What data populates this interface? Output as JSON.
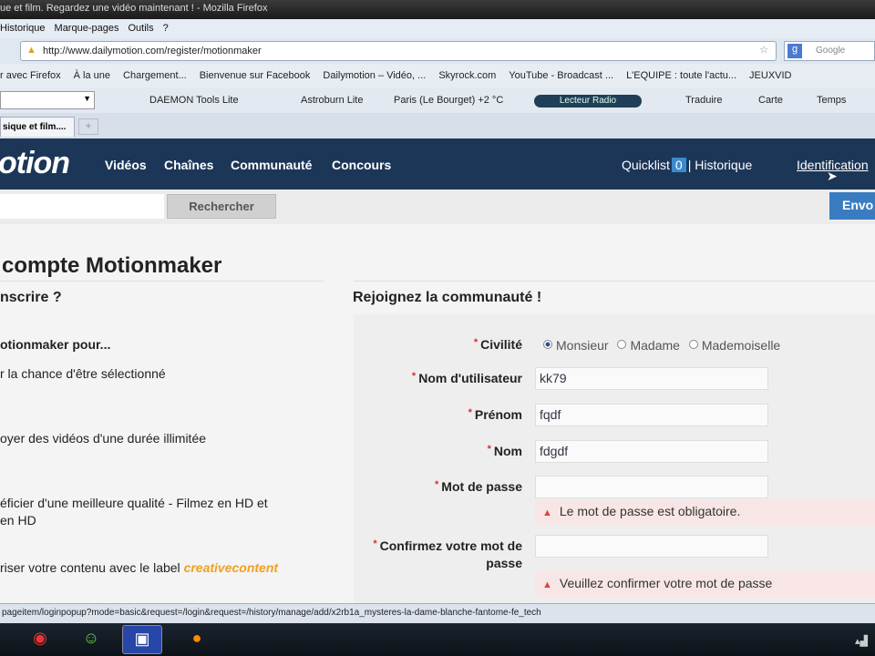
{
  "browser": {
    "window_title": "ue et film. Regardez une vidéo maintenant ! - Mozilla Firefox",
    "menu": [
      "Historique",
      "Marque-pages",
      "Outils",
      "?"
    ],
    "url": "http://www.dailymotion.com/register/motionmaker",
    "search_placeholder": "Google",
    "bookmarks": [
      "r avec Firefox",
      "À la une",
      "Chargement...",
      "Bienvenue sur Facebook",
      "Dailymotion – Vidéo, ...",
      "Skyrock.com",
      "YouTube - Broadcast ...",
      "L'EQUIPE : toute l'actu...",
      "JEUXVID"
    ],
    "toolbar": {
      "daemon": "DAEMON Tools Lite",
      "astroburn": "Astroburn Lite",
      "weather": "Paris (Le Bourget) +2 °C",
      "radio": "Lecteur Radio",
      "translate": "Traduire",
      "map": "Carte",
      "time": "Temps"
    },
    "tab_label": "sique et film....",
    "new_tab": "+",
    "status_text": "pageitem/loginpopup?mode=basic&request=/login&request=/history/manage/add/x2rb1a_mysteres-la-dame-blanche-fantome-fe_tech"
  },
  "site": {
    "logo": "otion",
    "nav": [
      "Vidéos",
      "Chaînes",
      "Communauté",
      "Concours"
    ],
    "quicklist_label": "Quicklist",
    "quicklist_count": "0",
    "separator": "|",
    "history": "Historique",
    "login": "Identification",
    "search_button": "Rechercher",
    "upload_button": "Envo"
  },
  "page": {
    "title": "compte Motionmaker",
    "left_heading": "nscrire ?",
    "left_subheading": "otionmaker pour...",
    "benefits": [
      "r la chance d'être sélectionné",
      "oyer des vidéos d'une durée illimitée",
      "éficier d'une meilleure qualité - Filmez en HD et",
      "en HD",
      "riser votre contenu avec le label"
    ],
    "creative_label": "creativecontent",
    "right_heading": "Rejoignez la communauté !",
    "form": {
      "required": "*",
      "civility_label": "Civilité",
      "civility_options": [
        "Monsieur",
        "Madame",
        "Mademoiselle"
      ],
      "username_label": "Nom d'utilisateur",
      "username_value": "kk79",
      "firstname_label": "Prénom",
      "firstname_value": "fqdf",
      "lastname_label": "Nom",
      "lastname_value": "fdgdf",
      "password_label": "Mot de passe",
      "password_error": "Le mot de passe est obligatoire.",
      "confirm_label_1": "Confirmez votre mot de",
      "confirm_label_2": "passe",
      "confirm_error": "Veuillez confirmer votre mot de passe"
    }
  },
  "colors": {
    "header": "#1c3658",
    "accent": "#3a7cc0",
    "error_bg": "#f8e6e6",
    "creative": "#f0a020"
  }
}
